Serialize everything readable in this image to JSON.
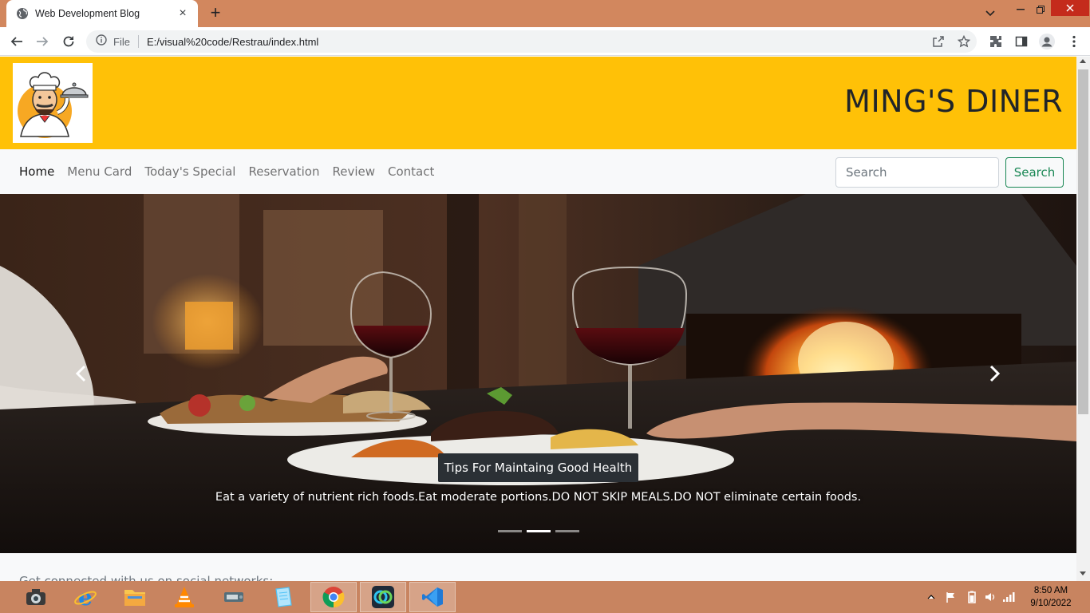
{
  "browser": {
    "tab_title": "Web Development Blog",
    "tab_close": "×",
    "new_tab": "+",
    "omnibox": {
      "scheme_label": "File",
      "url": "E:/visual%20code/Restrau/index.html"
    },
    "window_controls": [
      "chevron-down-icon",
      "minimize-icon",
      "restore-icon",
      "close-icon"
    ]
  },
  "site": {
    "brand": "MING'S DINER",
    "nav": {
      "items": [
        {
          "label": "Home",
          "active": true
        },
        {
          "label": "Menu Card",
          "active": false
        },
        {
          "label": "Today's Special",
          "active": false
        },
        {
          "label": "Reservation",
          "active": false
        },
        {
          "label": "Review",
          "active": false
        },
        {
          "label": "Contact",
          "active": false
        }
      ],
      "search_placeholder": "Search",
      "search_button": "Search"
    },
    "carousel": {
      "caption_title": "Tips For Maintaing Good Health",
      "caption_text": "Eat a variety of nutrient rich foods.Eat moderate portions.DO NOT SKIP MEALS.DO NOT eliminate certain foods.",
      "slide_count": 3,
      "active_slide": 2
    },
    "social_text": "Get connected with us on social networks:"
  },
  "colors": {
    "header_bg": "#ffc107",
    "search_button": "#198754",
    "titlebar": "#d2875e",
    "taskbar": "#c88460"
  },
  "taskbar": {
    "apps": [
      "camera-icon",
      "internet-explorer-icon",
      "file-explorer-icon",
      "vlc-icon",
      "device-icon",
      "notes-icon",
      "chrome-icon",
      "webex-icon",
      "vscode-icon"
    ],
    "clock": {
      "time": "8:50 AM",
      "date": "9/10/2022"
    }
  }
}
